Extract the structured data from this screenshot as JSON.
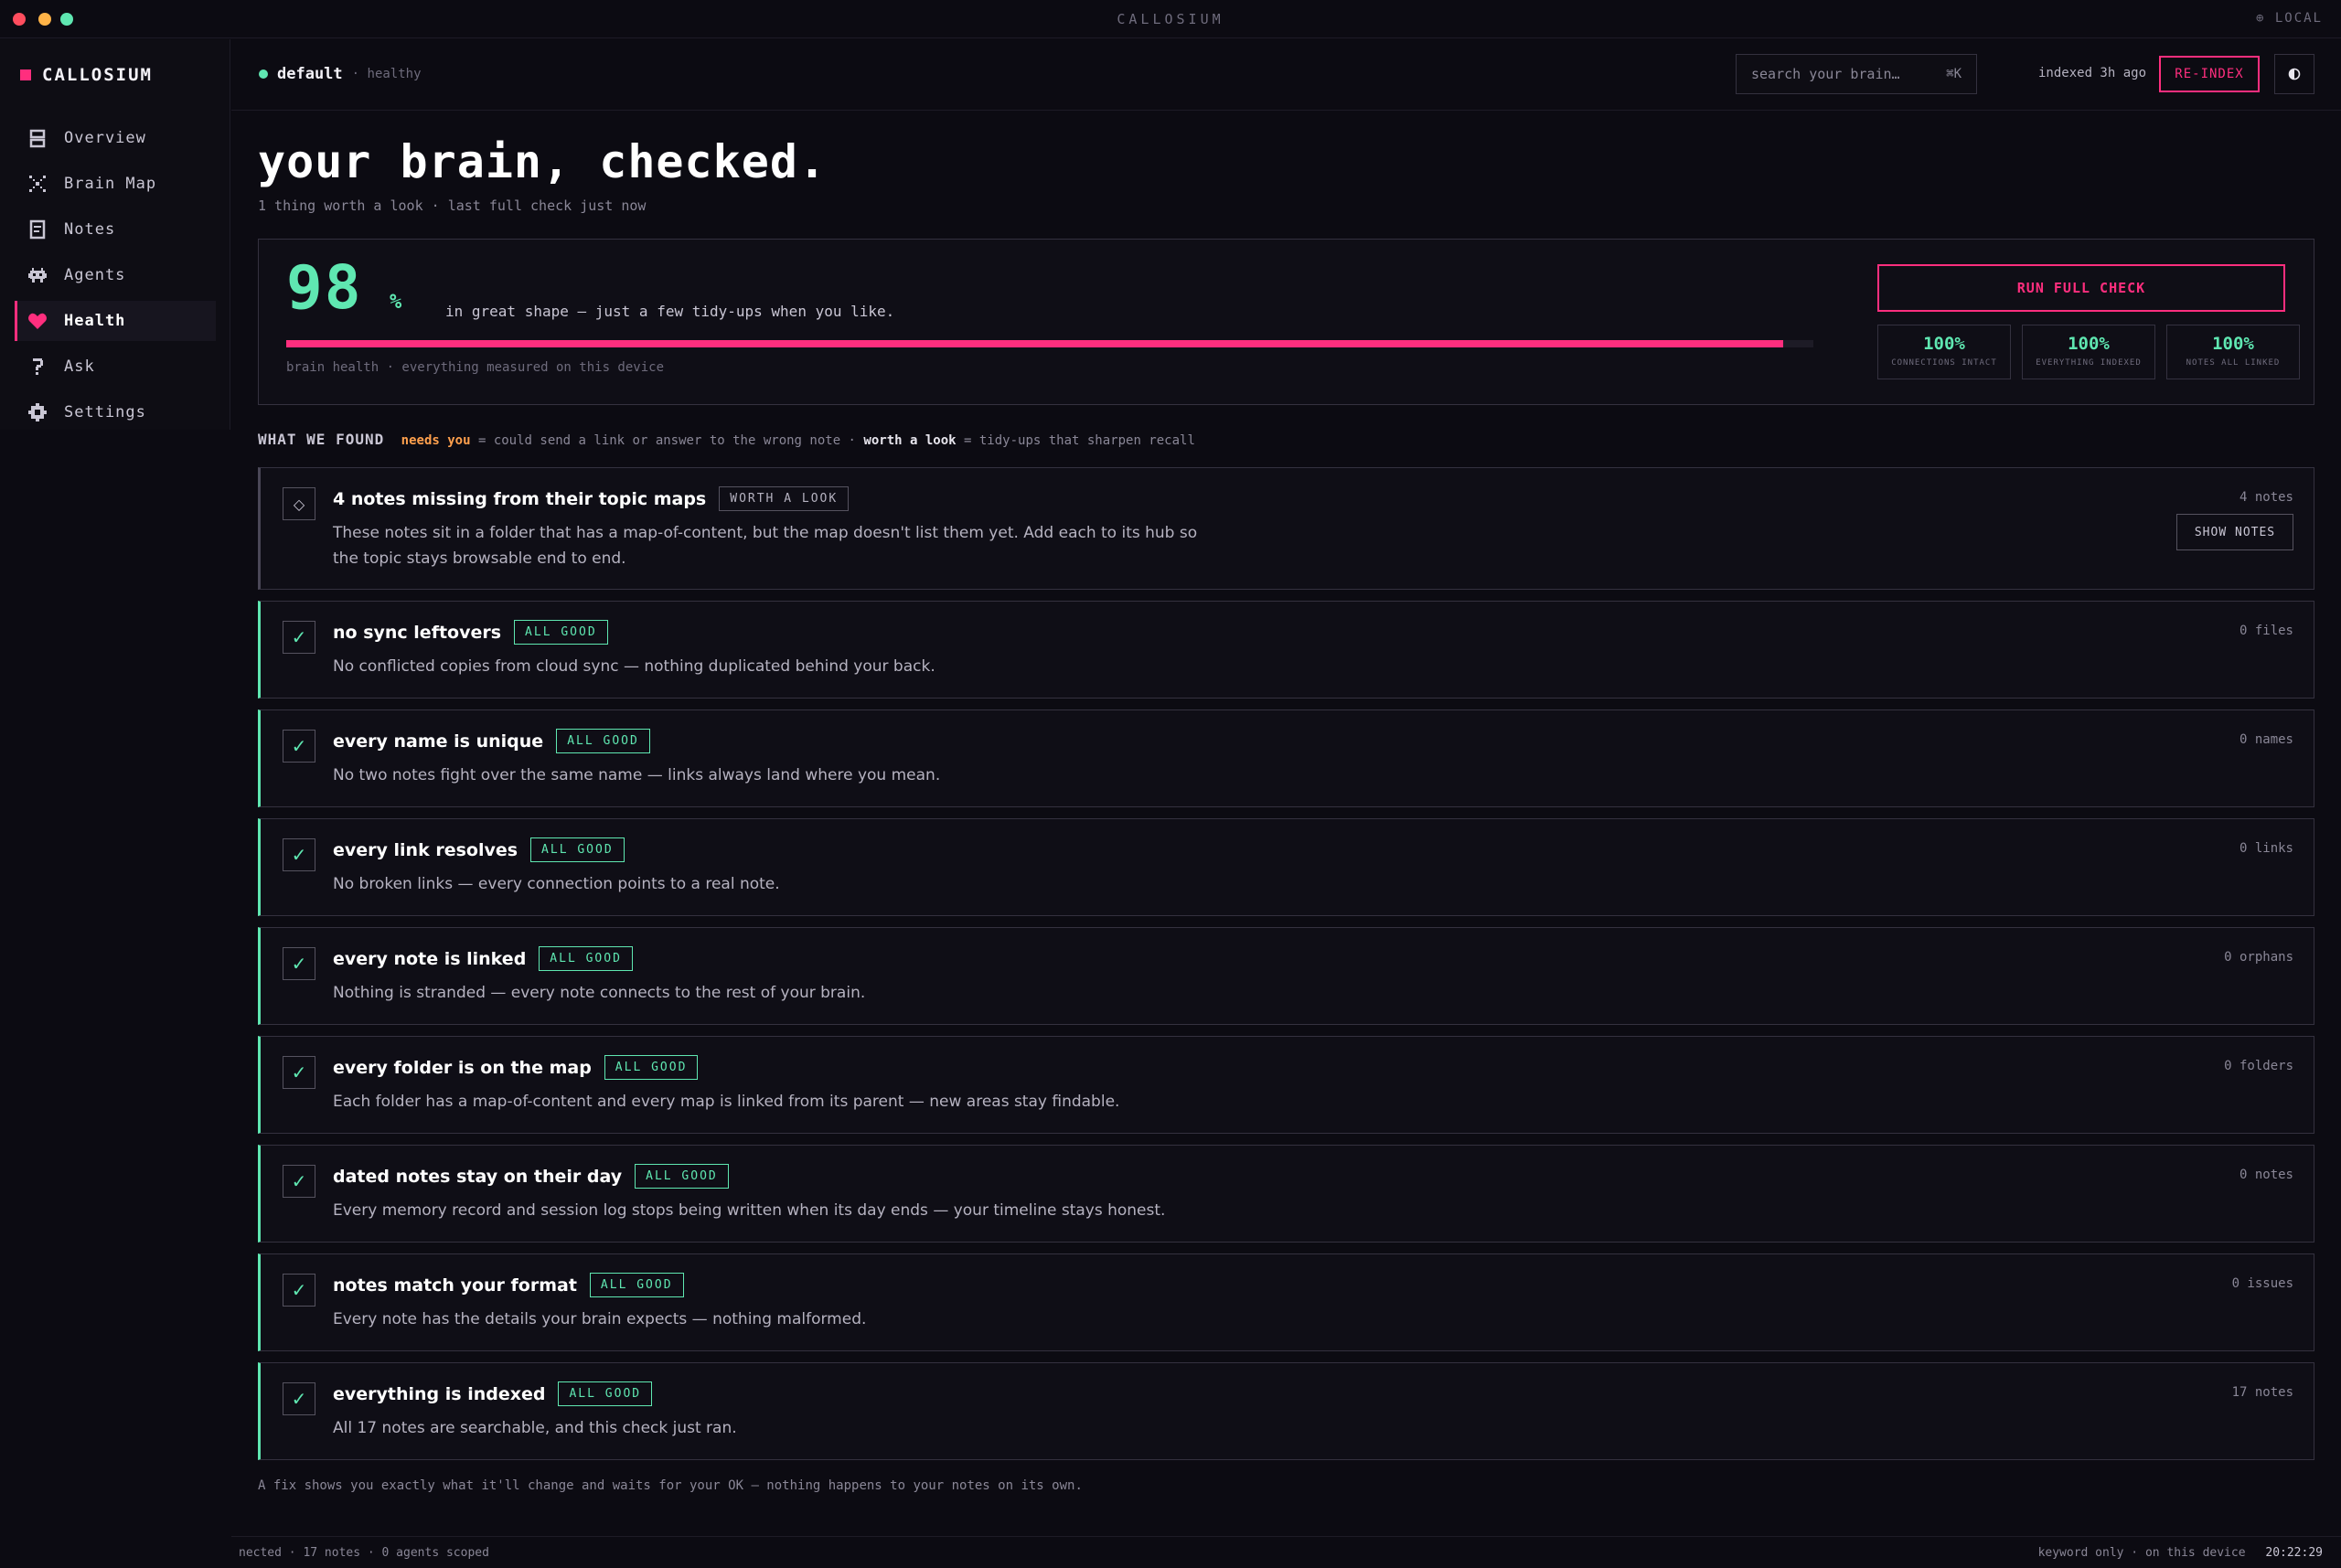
{
  "window": {
    "title": "CALLOSIUM",
    "mode": "LOCAL",
    "traffic_colors": [
      "#ff4d5e",
      "#ffb347",
      "#5fe7b1"
    ]
  },
  "sidebar": {
    "brand": "CALLOSIUM",
    "items": [
      {
        "label": "Overview",
        "icon": "overview-icon"
      },
      {
        "label": "Brain Map",
        "icon": "brain-map-icon"
      },
      {
        "label": "Notes",
        "icon": "notes-icon"
      },
      {
        "label": "Agents",
        "icon": "agents-icon"
      },
      {
        "label": "Health",
        "icon": "heart-icon",
        "active": true
      },
      {
        "label": "Ask",
        "icon": "question-icon"
      },
      {
        "label": "Settings",
        "icon": "gear-icon"
      }
    ]
  },
  "topbar": {
    "vault_name": "default",
    "vault_status": "· healthy",
    "search_placeholder": "search your brain…",
    "search_shortcut": "⌘K",
    "indexed": "indexed 3h ago",
    "reindex_label": "RE-INDEX",
    "theme_icon": "contrast-icon"
  },
  "page": {
    "title": "your brain, checked.",
    "subtitle": "1 thing worth a look · last full check just now"
  },
  "score": {
    "value": "98",
    "unit": "%",
    "fill_fraction": 0.98,
    "description": "in great shape — just a few tidy-ups when you like.",
    "caption": "brain health · everything measured on this device",
    "run_label": "RUN FULL CHECK",
    "stats": [
      {
        "value": "100%",
        "label": "CONNECTIONS INTACT"
      },
      {
        "value": "100%",
        "label": "EVERYTHING INDEXED"
      },
      {
        "value": "100%",
        "label": "NOTES ALL LINKED"
      }
    ]
  },
  "found": {
    "label": "WHAT WE FOUND",
    "needs_you": "needs you",
    "needs_desc": "= could send a link or answer to the wrong note ·",
    "worth": "worth a look",
    "worth_desc": "= tidy-ups that sharpen recall"
  },
  "checks": [
    {
      "title": "4 notes missing from their topic maps",
      "badge": "WORTH A LOOK",
      "desc": "These notes sit in a folder that has a map-of-content, but the map doesn't list them yet. Add each to its hub so the topic stays browsable end to end.",
      "count": "4 notes",
      "action": "SHOW NOTES",
      "mark": "◇",
      "status": "warn"
    },
    {
      "title": "no sync leftovers",
      "badge": "ALL GOOD",
      "desc": "No conflicted copies from cloud sync — nothing duplicated behind your back.",
      "count": "0 files",
      "mark": "✓",
      "status": "ok"
    },
    {
      "title": "every name is unique",
      "badge": "ALL GOOD",
      "desc": "No two notes fight over the same name — links always land where you mean.",
      "count": "0 names",
      "mark": "✓",
      "status": "ok"
    },
    {
      "title": "every link resolves",
      "badge": "ALL GOOD",
      "desc": "No broken links — every connection points to a real note.",
      "count": "0 links",
      "mark": "✓",
      "status": "ok"
    },
    {
      "title": "every note is linked",
      "badge": "ALL GOOD",
      "desc": "Nothing is stranded — every note connects to the rest of your brain.",
      "count": "0 orphans",
      "mark": "✓",
      "status": "ok"
    },
    {
      "title": "every folder is on the map",
      "badge": "ALL GOOD",
      "desc": "Each folder has a map-of-content and every map is linked from its parent — new areas stay findable.",
      "count": "0 folders",
      "mark": "✓",
      "status": "ok"
    },
    {
      "title": "dated notes stay on their day",
      "badge": "ALL GOOD",
      "desc": "Every memory record and session log stops being written when its day ends — your timeline stays honest.",
      "count": "0 notes",
      "mark": "✓",
      "status": "ok"
    },
    {
      "title": "notes match your format",
      "badge": "ALL GOOD",
      "desc": "Every note has the details your brain expects — nothing malformed.",
      "count": "0 issues",
      "mark": "✓",
      "status": "ok"
    },
    {
      "title": "everything is indexed",
      "badge": "ALL GOOD",
      "desc": "All 17 notes are searchable, and this check just ran.",
      "count": "17 notes",
      "mark": "✓",
      "status": "ok"
    }
  ],
  "footer_note": "A fix shows you exactly what it'll change and waits for your OK — nothing happens to your notes on its own.",
  "statusbar": {
    "left": "nected · 17 notes · 0 agents scoped",
    "right": "keyword only · on this device",
    "time": "20:22:29"
  },
  "colors": {
    "accent": "#ff2e7e",
    "good": "#5fe7b1",
    "warn": "#ffa04d"
  }
}
